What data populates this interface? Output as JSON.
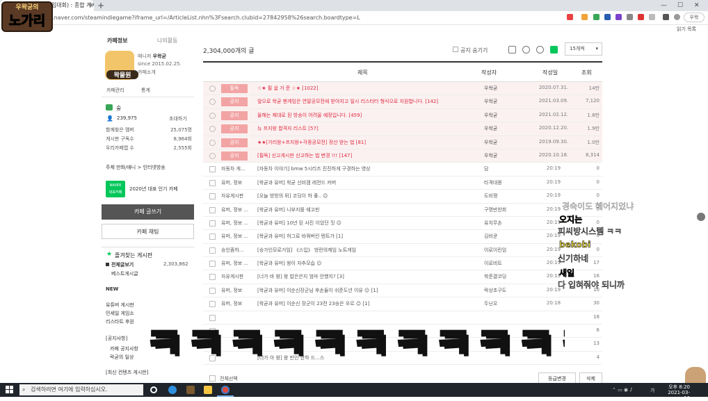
{
  "browser": {
    "tab_title": "가격인증(게임대회) : 종합 게시판",
    "url": "cafe.naver.com/steamindiegame?iframe_url=/ArticleList.nhn%3Fsearch.clubid=27842958%26search.boardtype=L",
    "profile_label": "우왁",
    "bookmark_label": "읽기 목록"
  },
  "logo": {
    "top": "우왁굳의",
    "main": "노가리"
  },
  "cafe_side": {
    "tab1": "카페정보",
    "tab2": "나의활동",
    "manager_label": "매니저",
    "manager_name": "우왁굳",
    "since": "since 2015.02.25.",
    "intro": "카페소개",
    "avatar_text": "왁물원",
    "admin_link": "카페관리",
    "stats_link": "통계",
    "level": "숲",
    "members_value": "239,975",
    "invite": "초대하기",
    "stats": [
      {
        "label": "함께찾은 멤버",
        "value": "25,075명"
      },
      {
        "label": "게시판 구독수",
        "value": "8,964회"
      },
      {
        "label": "우리카페앱 수",
        "value": "2,555회"
      }
    ],
    "topic": "주제  만화/애니 > 인터넷방송",
    "badge_top": "NAVER",
    "badge_bottom": "대표카페",
    "award": "2020년 대표 인기 카페",
    "write_button": "카페 글쓰기",
    "chat_button": "카페 채팅",
    "fav_title": "즐겨찾는 게시판",
    "all_posts": "전체글보기",
    "all_posts_count": "2,303,862",
    "best_posts": "베스트게시글",
    "new_label": "NEW",
    "new_boards": [
      "유튜버 게시판",
      "민세일 게임소",
      "리스타트 후원"
    ],
    "notice_section": "[공지사항]",
    "notice_boards": [
      "카페 공지사항",
      "락굳의 일상"
    ],
    "latest_section": "[최신 컨텐츠 게시판]"
  },
  "board": {
    "total_count": "2,304,000",
    "total_suffix": "개의 글",
    "hide_notice": "공지 숨기기",
    "per_page": "15개씩",
    "columns": {
      "title": "제목",
      "author": "작성자",
      "date": "작성일",
      "views": "조회"
    },
    "rows": [
      {
        "kind": "notice",
        "cat": "필독",
        "title": "☆★ 필 쉽 거 준 ☆★ [1022]",
        "author": "우왁굳",
        "date": "2020.07.31.",
        "views": "14만"
      },
      {
        "kind": "notice",
        "cat": "공지",
        "title": "앞으로 왁굳 팬게임은 연말공모전에 받아지고 일시 리스타터 형식으로 지원합니다. [142]",
        "author": "우왁굳",
        "date": "2021.03.09.",
        "views": "7,120"
      },
      {
        "kind": "notice",
        "cat": "공지",
        "title": "올해는 제대로 된 방송이 어려울 예정입니다. [459]",
        "author": "우왁굳",
        "date": "2021.02.12.",
        "views": "1.8만"
      },
      {
        "kind": "notice",
        "cat": "공지",
        "title": "뉴 프지왕 합격자 리스트 [57]",
        "author": "우왁굳",
        "date": "2020.12.20.",
        "views": "1.9만"
      },
      {
        "kind": "notice",
        "cat": "공지",
        "title": "★★[가리왕+프지왕+각종공모전] 정산 받는 법 [81]",
        "author": "우왁굳",
        "date": "2019.09.30.",
        "views": "1.0만"
      },
      {
        "kind": "notice",
        "cat": "공지",
        "title": "[필독] 신고게시판 신고하는 법 변경 !!! [147]",
        "author": "우왁굳",
        "date": "2020.10.18.",
        "views": "8,314"
      },
      {
        "kind": "normal",
        "cat": "자동차 게...",
        "title": "[자동차 이야기] bmw 5시리즈 진진하게 구경하는 영상",
        "author": "담",
        "date": "20:19",
        "views": "0"
      },
      {
        "kind": "normal",
        "cat": "유머, 정보",
        "title": "[왁굳과 유머] 왁굳 신비겜 레전드 커버",
        "author": "타격대몽",
        "date": "20:19",
        "views": "0"
      },
      {
        "kind": "normal",
        "cat": "자유게시판",
        "title": "[오늘 방방의 뒤] 코딩이 하 좋.. ☺",
        "author": "도비쟁",
        "date": "20:19",
        "views": "0"
      },
      {
        "kind": "normal",
        "cat": "유머, 정보 ...",
        "title": "[왁굳과 유머] 니부지를 쉐고핀",
        "author": "구명반찬회",
        "date": "20:19",
        "views": "0"
      },
      {
        "kind": "normal",
        "cat": "유머, 정보 ...",
        "title": "[왁굳과 유머] 10년 된 사진 이었던 짓 ☺",
        "author": "유치무손",
        "date": "20:19",
        "views": "0"
      },
      {
        "kind": "normal",
        "cat": "유머, 정보 ...",
        "title": "[왁굳과 유머] 허그로 바꿔버린 텐트가 [1]",
        "author": "김비쿤",
        "date": "20:19",
        "views": "0"
      },
      {
        "kind": "normal",
        "cat": "승인좀하...",
        "title": "[승가인모로거임] 《스입》 방란의제임 노트게임",
        "author": "이로이린임",
        "date": "20:19",
        "views": "0"
      },
      {
        "kind": "normal",
        "cat": "유머, 정보 ...",
        "title": "[왁굳과 유머] 왕이 자추모습 ☺",
        "author": "이로비트",
        "date": "20:19",
        "views": "17"
      },
      {
        "kind": "normal",
        "cat": "자유게시판",
        "title": "[너가 바 왕] 왕 밥은은지 엄마 안했지? [3]",
        "author": "왁준결코딩",
        "date": "20:19",
        "views": "16"
      },
      {
        "kind": "normal",
        "cat": "유머, 정보",
        "title": "[왁굳과 유머] 이순신장군님 후손들이 쉬준도년 이유 ☺ [1]",
        "author": "락상초구도",
        "date": "20:19",
        "views": "10"
      },
      {
        "kind": "normal",
        "cat": "유머, 정보",
        "title": "[왁굳과 유머] 이순신 장군이 23전 23승은 우르 ☺ [1]",
        "author": "두닌오",
        "date": "20:18",
        "views": "30"
      },
      {
        "kind": "normal",
        "cat": "",
        "title": "",
        "author": "",
        "date": "",
        "views": "18"
      },
      {
        "kind": "normal",
        "cat": "",
        "title": "",
        "author": "",
        "date": "",
        "views": "6"
      },
      {
        "kind": "normal",
        "cat": "",
        "title": "",
        "author": "",
        "date": "",
        "views": "13"
      },
      {
        "kind": "normal",
        "cat": "",
        "title": "[너가 아 왕] 왕 만인 한하 드...스",
        "author": "",
        "date": "",
        "views": "4"
      }
    ],
    "select_all": "전체선택",
    "level_change": "등급변경",
    "delete": "삭제"
  },
  "chat_overlay": [
    {
      "name": "",
      "msg": "경숙이도 헤어지었냐"
    },
    {
      "name": "오지는",
      "msg": "피씨방시스템 ㅋㅋ"
    },
    {
      "name": "bekobi",
      "msg": "신기하네"
    },
    {
      "name": "새일",
      "msg": "다 입혀줘야 되니까"
    }
  ],
  "big_overlay": "ㅋㅋㅋㅋㅋㅋㅋㅋㅋㅋㅋ",
  "taskbar": {
    "search_placeholder": "검색하려면 여기에 입력하십시오.",
    "time": "오후 8:20",
    "date": "2021-03-16",
    "lang": "가"
  },
  "colors": {
    "accent_green": "#03c75a",
    "notice_red": "#e0283c",
    "notice_bg": "#fbf1f1"
  }
}
